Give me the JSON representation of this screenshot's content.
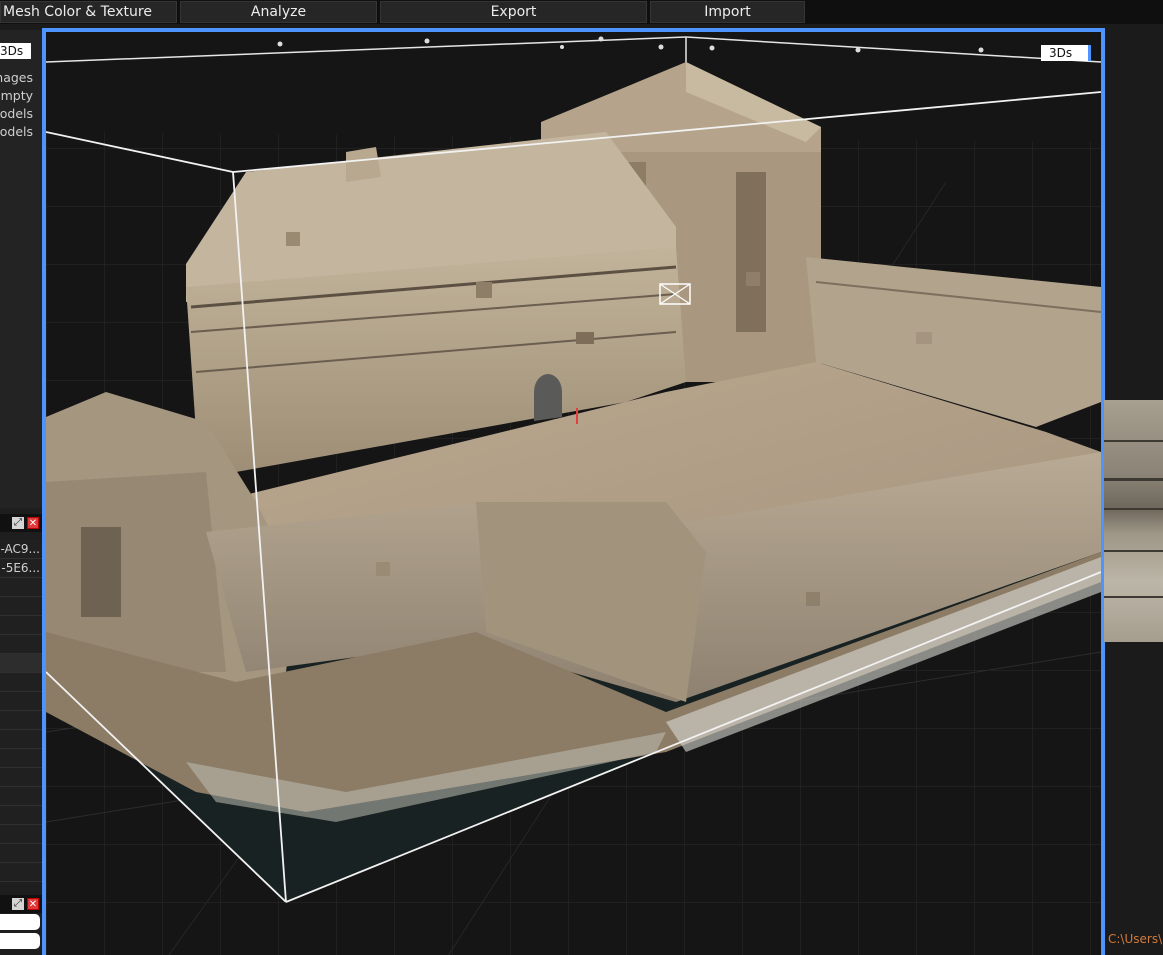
{
  "toolbar": {
    "mesh_color_texture": "Mesh Color & Texture",
    "analyze": "Analyze",
    "export": "Export",
    "import": "Import"
  },
  "left_panel": {
    "view_select": "3Ds",
    "lines": [
      "nages",
      "empty",
      "nodels",
      "nodels"
    ],
    "rows": [
      "-AC9...",
      "-5E6..."
    ]
  },
  "viewport": {
    "view_label": "3Ds"
  },
  "status": {
    "path": "C:\\Users\\"
  },
  "colors": {
    "accent": "#4d94ff",
    "close": "#e03a3a",
    "path_text": "#d17a3a"
  }
}
